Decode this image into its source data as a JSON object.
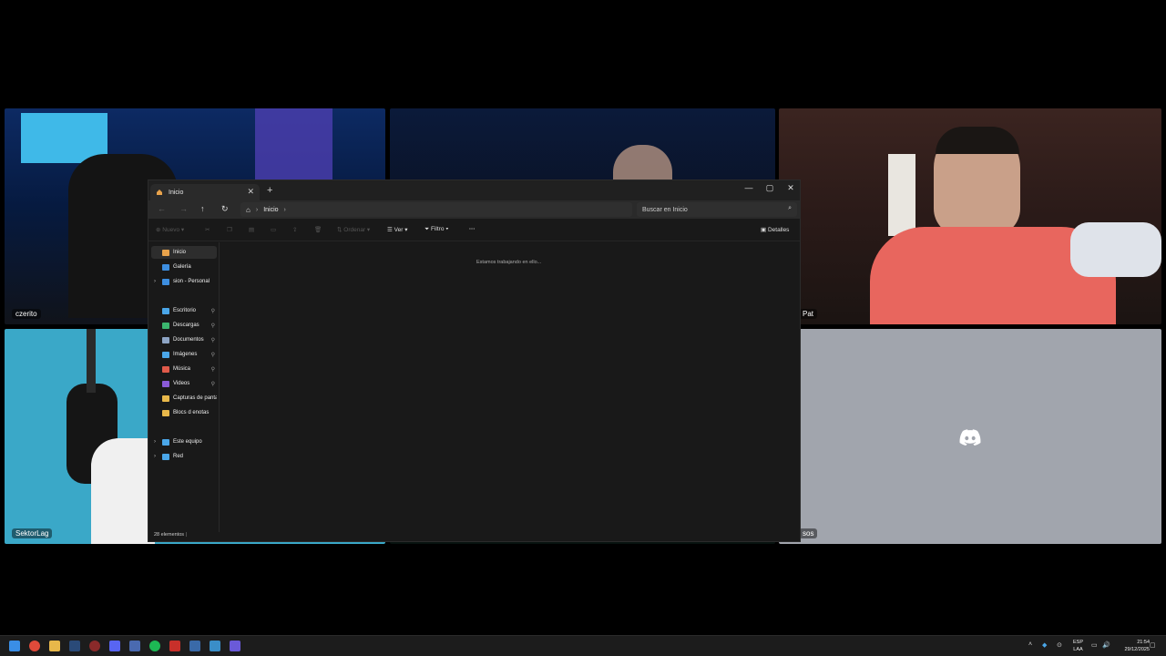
{
  "participants": {
    "top_left": "czerito",
    "top_right": "Pat",
    "bottom_left": "SektorLag",
    "bottom_right_partial": "sos"
  },
  "explorer": {
    "tab_title": "Inicio",
    "address_path": "Inicio",
    "search_placeholder": "Buscar en Inicio",
    "toolbar": {
      "new_label": "Nuevo",
      "sort_label": "Ordenar",
      "view_label": "Ver",
      "filter_label": "Filtro",
      "more_label": "···",
      "details_label": "Detalles"
    },
    "sidebar": {
      "items": [
        {
          "label": "Inicio",
          "icon": "home-icon",
          "color": "#e8a24b"
        },
        {
          "label": "Galería",
          "icon": "gallery-icon",
          "color": "#3d8ee0"
        },
        {
          "label": "sion - Personal",
          "icon": "onedrive-icon",
          "color": "#3d8ee0"
        },
        {
          "label": "Escritorio",
          "icon": "desktop-icon",
          "color": "#4aa6e8"
        },
        {
          "label": "Descargas",
          "icon": "download-icon",
          "color": "#3bb56e"
        },
        {
          "label": "Documentos",
          "icon": "documents-icon",
          "color": "#8da4c4"
        },
        {
          "label": "Imágenes",
          "icon": "pictures-icon",
          "color": "#4aa6e8"
        },
        {
          "label": "Música",
          "icon": "music-icon",
          "color": "#e05a4a"
        },
        {
          "label": "Videos",
          "icon": "videos-icon",
          "color": "#8a5ad8"
        },
        {
          "label": "Capturas de pantall",
          "icon": "folder-icon",
          "color": "#e8b84a"
        },
        {
          "label": "Blocs d enotas",
          "icon": "folder-icon",
          "color": "#e8b84a"
        },
        {
          "label": "Este equipo",
          "icon": "pc-icon",
          "color": "#4aa6e8"
        },
        {
          "label": "Red",
          "icon": "network-icon",
          "color": "#4aa6e8"
        }
      ]
    },
    "content_message": "Estamos trabajando en ello...",
    "status": "28 elementos"
  },
  "taskbar": {
    "language_line1": "ESP",
    "language_line2": "LAA",
    "time": "21:54",
    "date": "29/12/2025"
  }
}
